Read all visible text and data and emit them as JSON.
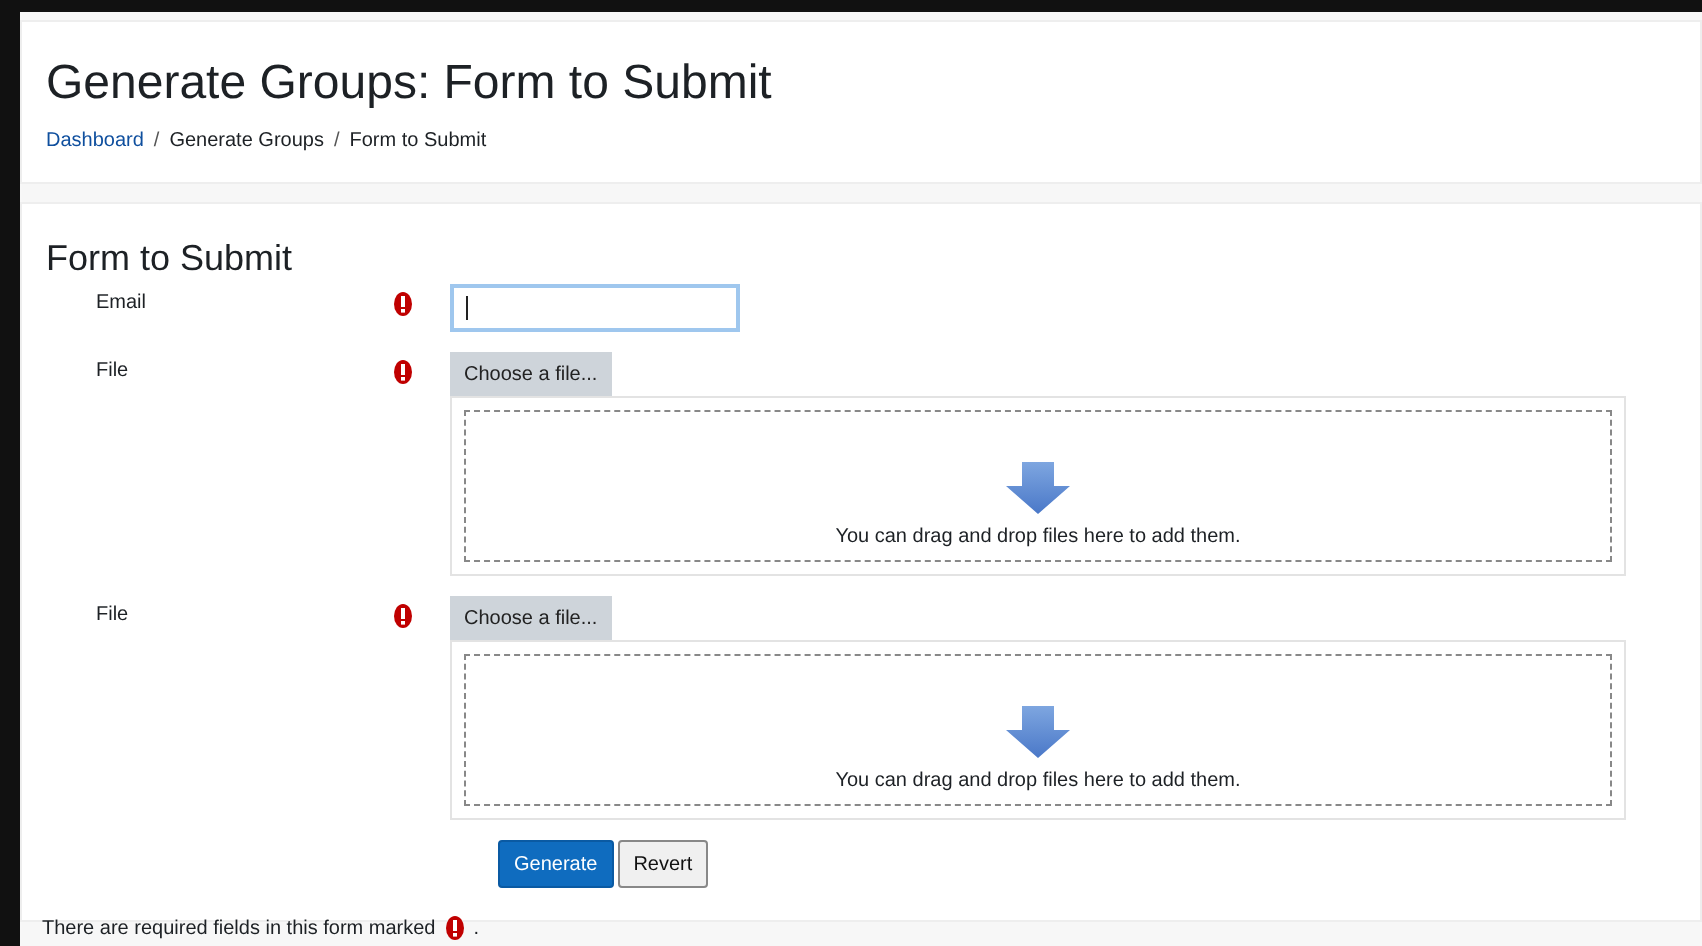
{
  "page": {
    "title": "Generate Groups: Form to Submit"
  },
  "breadcrumb": [
    {
      "label": "Dashboard",
      "link": true
    },
    {
      "separator": "/",
      "label": "Generate Groups",
      "link": false
    },
    {
      "separator": "/",
      "label": "Form to Submit",
      "link": false
    }
  ],
  "form": {
    "title": "Form to Submit",
    "fields": [
      {
        "kind": "text",
        "label": "Email",
        "required": true,
        "focused": true
      },
      {
        "kind": "file",
        "label": "File",
        "required": true,
        "button": "Choose a file...",
        "hint": "You can drag and drop files here to add them."
      },
      {
        "kind": "file",
        "label": "File",
        "required": true,
        "button": "Choose a file...",
        "hint": "You can drag and drop files here to add them."
      }
    ],
    "buttons": [
      {
        "label": "Generate",
        "kind": "primary"
      },
      {
        "label": "Revert",
        "kind": "secondary"
      }
    ],
    "note": "There are required fields in this form marked",
    "note_end": "."
  }
}
